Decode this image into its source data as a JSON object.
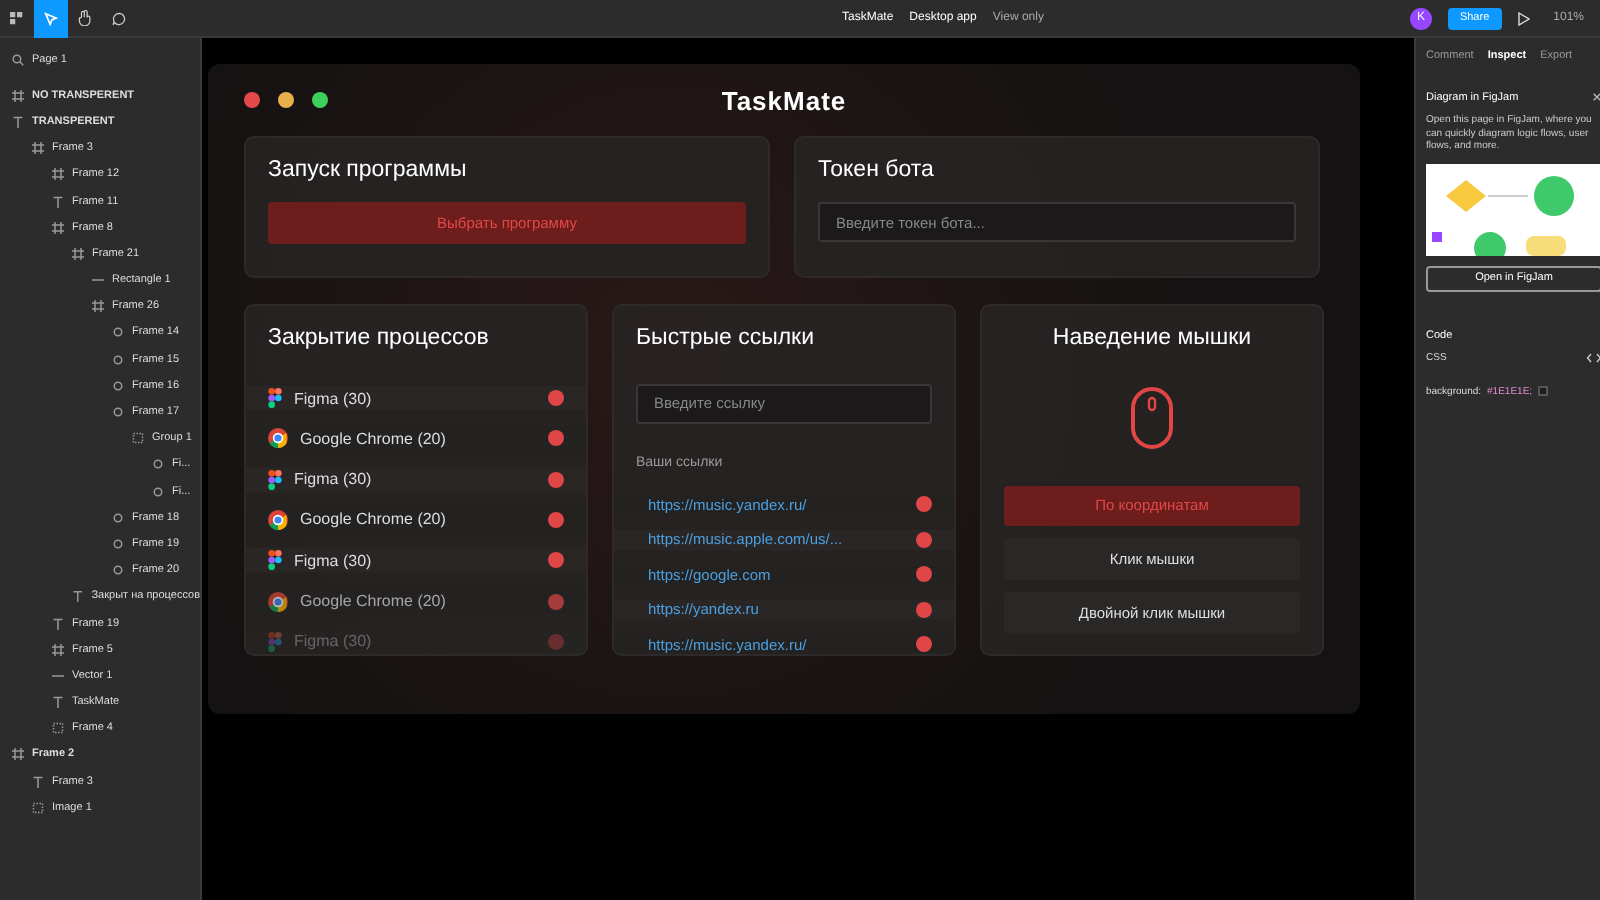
{
  "toolbar": {
    "file_title": "TaskMate",
    "file_subtitle": "Desktop app",
    "access": "View only",
    "avatar": "K",
    "share": "Share",
    "zoom": "101%"
  },
  "layers": {
    "page": "Page 1",
    "items": [
      {
        "name": "NO TRANSPERENT",
        "kind": "frame",
        "top": true
      },
      {
        "name": "TRANSPERENT",
        "kind": "text",
        "top": true,
        "children": [
          {
            "name": "Frame 3",
            "kind": "frame",
            "children": [
              {
                "name": "Frame 12",
                "kind": "frame"
              },
              {
                "name": "Frame 11",
                "kind": "text"
              },
              {
                "name": "Frame 8",
                "kind": "frame",
                "children": [
                  {
                    "name": "Frame 21",
                    "kind": "frame",
                    "children": [
                      {
                        "name": "Rectangle 1",
                        "kind": "rect"
                      },
                      {
                        "name": "Frame 26",
                        "kind": "frame",
                        "children": [
                          {
                            "name": "Frame 14",
                            "kind": "component"
                          },
                          {
                            "name": "Frame 15",
                            "kind": "component"
                          },
                          {
                            "name": "Frame 16",
                            "kind": "component"
                          },
                          {
                            "name": "Frame 17",
                            "kind": "component",
                            "children": [
                              {
                                "name": "Group 1",
                                "kind": "group",
                                "children": [
                                  {
                                    "name": "Fi...",
                                    "kind": "component"
                                  },
                                  {
                                    "name": "Fi...",
                                    "kind": "component"
                                  }
                                ]
                              }
                            ]
                          },
                          {
                            "name": "Frame 18",
                            "kind": "component"
                          },
                          {
                            "name": "Frame 19",
                            "kind": "component"
                          },
                          {
                            "name": "Frame 20",
                            "kind": "component"
                          }
                        ]
                      }
                    ]
                  },
                  {
                    "name": "Закрыт на процессов",
                    "kind": "text"
                  }
                ]
              },
              {
                "name": "Frame 19",
                "kind": "text"
              },
              {
                "name": "Frame 5",
                "kind": "frame"
              },
              {
                "name": "Vector 1",
                "kind": "rect"
              },
              {
                "name": "TaskMate",
                "kind": "text"
              },
              {
                "name": "Frame 4",
                "kind": "group"
              }
            ]
          }
        ]
      },
      {
        "name": "Frame 2",
        "kind": "frame",
        "top": true,
        "children": [
          {
            "name": "Frame 3",
            "kind": "text"
          },
          {
            "name": "Image 1",
            "kind": "group"
          }
        ]
      }
    ]
  },
  "app": {
    "title": "TaskMate",
    "launch": {
      "title": "Запуск программы",
      "button": "Выбрать программу"
    },
    "token": {
      "title": "Токен бота",
      "placeholder": "Введите токен бота..."
    },
    "processes": {
      "title": "Закрытие процессов",
      "items": [
        {
          "kind": "figma",
          "name": "Figma (30)"
        },
        {
          "kind": "chrome",
          "name": "Google Chrome (20)"
        },
        {
          "kind": "figma",
          "name": "Figma (30)"
        },
        {
          "kind": "chrome",
          "name": "Google Chrome (20)"
        },
        {
          "kind": "figma",
          "name": "Figma (30)"
        },
        {
          "kind": "chrome",
          "name": "Google Chrome (20)"
        },
        {
          "kind": "figma",
          "name": "Figma (30)"
        }
      ]
    },
    "links": {
      "title": "Быстрые ссылки",
      "placeholder": "Введите ссылку",
      "subtitle": "Ваши ссылки",
      "items": [
        "https://music.yandex.ru/",
        "https://music.apple.com/us/...",
        "https://google.com",
        "https://yandex.ru",
        "https://music.yandex.ru/"
      ]
    },
    "mouse": {
      "title": "Наведение мышки",
      "buttons": [
        {
          "label": "По координатам",
          "selected": true
        },
        {
          "label": "Клик мышки",
          "selected": false
        },
        {
          "label": "Двойной клик мышки",
          "selected": false
        }
      ]
    }
  },
  "inspector": {
    "tabs": [
      {
        "label": "Comment",
        "selected": false
      },
      {
        "label": "Inspect",
        "selected": true
      },
      {
        "label": "Export",
        "selected": false
      }
    ],
    "promo": {
      "title": "Diagram in FigJam",
      "text": "Open this page in FigJam, where you can quickly diagram logic flows, user flows, and more.",
      "button": "Open in FigJam"
    },
    "code": {
      "title": "Code",
      "language": "CSS",
      "property": "background:",
      "value": "#1E1E1E;"
    }
  }
}
